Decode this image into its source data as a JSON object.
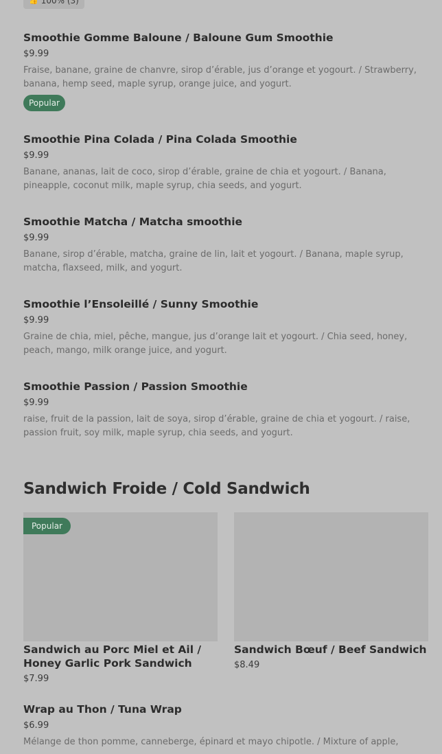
{
  "rating": {
    "icon": "thumbs-up-icon",
    "text": "100% (3)"
  },
  "items": [
    {
      "title": "Smoothie Gomme Baloune / Baloune Gum Smoothie",
      "price": "$9.99",
      "desc": "Fraise, banane, graine de chanvre, sirop d’érable, jus d’orange et yogourt. / Strawberry, banana, hemp seed, maple syrup, orange juice, and yogurt.",
      "badge": "Popular"
    },
    {
      "title": "Smoothie Pina Colada / Pina Colada Smoothie",
      "price": "$9.99",
      "desc": "Banane, ananas, lait de coco, sirop d’érable, graine de chia et yogourt. / Banana, pineapple, coconut milk, maple syrup, chia seeds, and yogurt."
    },
    {
      "title": "Smoothie Matcha / Matcha smoothie",
      "price": "$9.99",
      "desc": "Banane, sirop d’érable, matcha, graine de lin, lait et yogourt. / Banana, maple syrup, matcha, flaxseed, milk, and yogurt."
    },
    {
      "title": "Smoothie l’Ensoleillé / Sunny Smoothie",
      "price": "$9.99",
      "desc": "Graine de chia, miel, pêche, mangue, jus d’orange lait et yogourt. / Chia seed, honey, peach, mango, milk orange juice, and yogurt."
    },
    {
      "title": "Smoothie Passion / Passion Smoothie",
      "price": "$9.99",
      "desc": "raise, fruit de la passion, lait de soya, sirop d’érable, graine de chia et yogourt. / raise, passion fruit, soy milk, maple syrup, chia seeds, and yogurt."
    }
  ],
  "section": {
    "title": "Sandwich Froide / Cold Sandwich"
  },
  "cards": [
    {
      "title": "Sandwich au Porc Miel et Ail / Honey Garlic Pork Sandwich",
      "price": "$7.99",
      "badge": "Popular"
    },
    {
      "title": "Sandwich Bœuf / Beef Sandwich",
      "price": "$8.49"
    }
  ],
  "wrap": {
    "title": "Wrap au Thon / Tuna Wrap",
    "price": "$6.99",
    "desc": "Mélange de thon pomme, canneberge, épinard et mayo chipotle. / Mixture of apple,"
  },
  "colors": {
    "badge": "#3f7a5a",
    "background": "#c1c1c1",
    "placeholder": "#b3b3b3"
  }
}
